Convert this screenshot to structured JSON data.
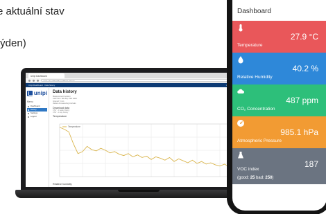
{
  "intro": {
    "line1": "e aktuální stav",
    "line3": "týden)"
  },
  "laptop": {
    "browser": {
      "tab_title": "Unipi Dashboard",
      "address": "unipi-cloud/dashboard/data-history"
    },
    "app_header": {
      "left": "Unipi Dashboard · Data history",
      "right": "Unipi.technology · Settings"
    },
    "sidebar": {
      "logo_text": "unipi",
      "section": "Menu",
      "items": [
        "Dashboard",
        "History",
        "Settings",
        "Logout"
      ],
      "active_index": 1
    },
    "page": {
      "title": "Data history",
      "meta_lines": [
        "Measurement location",
        "Last hour / last day / last week",
        "Interval: 5 min",
        "Values & measuring intervals"
      ],
      "download_title": "Download data",
      "download_lines": [
        "CSV - 1 week history",
        "CSV - 1 day history"
      ],
      "temperature_title": "Temperature",
      "humidity_title": "Relative humidity"
    },
    "chart_data": {
      "type": "line",
      "title": "",
      "x": [
        0,
        1,
        2,
        3,
        4,
        5,
        6,
        7,
        8,
        9,
        10,
        11,
        12,
        13,
        14,
        15,
        16,
        17,
        18,
        19,
        20,
        21,
        22,
        23,
        24,
        25,
        26,
        27,
        28,
        29,
        30,
        31,
        32,
        33,
        34,
        35,
        36,
        37,
        38,
        39,
        40
      ],
      "series": [
        {
          "name": "Temperature",
          "color": "#d9b44a",
          "values": [
            27.5,
            27.2,
            26.8,
            25.0,
            23.5,
            23.8,
            24.6,
            24.1,
            23.9,
            24.3,
            24.0,
            23.6,
            23.8,
            23.4,
            23.2,
            23.5,
            23.0,
            23.3,
            22.9,
            23.1,
            22.6,
            23.0,
            22.8,
            22.5,
            22.9,
            22.3,
            22.7,
            22.4,
            22.1,
            22.5,
            22.0,
            22.3,
            21.9,
            22.1,
            21.8,
            21.6,
            21.9,
            21.5,
            21.3,
            21.6,
            21.2
          ]
        }
      ],
      "ylim": [
        20,
        28
      ],
      "grid": true
    }
  },
  "phone": {
    "title": "Dashboard",
    "cards": [
      {
        "key": "temperature",
        "value": "27.9 °C",
        "label": "Temperature",
        "color": "#e9575a",
        "icon": "thermometer-icon"
      },
      {
        "key": "humidity",
        "value": "40.2 %",
        "label": "Relative Humidity",
        "color": "#2e88d9",
        "icon": "water-drop-icon"
      },
      {
        "key": "co2",
        "value": "487 ppm",
        "label": "CO₂ Concentration",
        "color": "#2dbf7a",
        "icon": "cloud-icon"
      },
      {
        "key": "pressure",
        "value": "985.1 hPa",
        "label": "Atmospheric Pressure",
        "color": "#f29b33",
        "icon": "gauge-icon"
      },
      {
        "key": "voc",
        "value": "187",
        "label": "VOC index",
        "sublabel_pre": "(good: ",
        "sublabel_good": "25",
        "sublabel_mid": " bad: ",
        "sublabel_bad": "250",
        "sublabel_post": ")",
        "color": "#6b7481",
        "icon": "flask-icon"
      }
    ]
  }
}
